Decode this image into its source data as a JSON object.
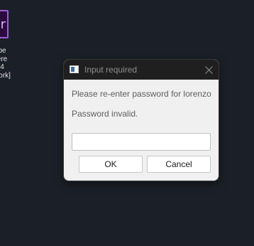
{
  "desktop": {
    "shortcut_label": "be\nere\n4\nwork]",
    "shortcut_glyph": "r",
    "shortcut_icon": "application-shortcut-icon"
  },
  "dialog": {
    "title": "Input required",
    "prompt": "Please re-enter password for lorenzo",
    "error": "Password invalid.",
    "input_value": "",
    "ok_label": "OK",
    "cancel_label": "Cancel",
    "icons": {
      "app": "window-app-icon",
      "close": "close-icon"
    }
  },
  "colors": {
    "desktop_bg": "#1b1f27",
    "titlebar_bg": "#1f1f1f",
    "dialog_bg": "#f0f0f0",
    "shortcut_border": "#9b5fd6"
  }
}
